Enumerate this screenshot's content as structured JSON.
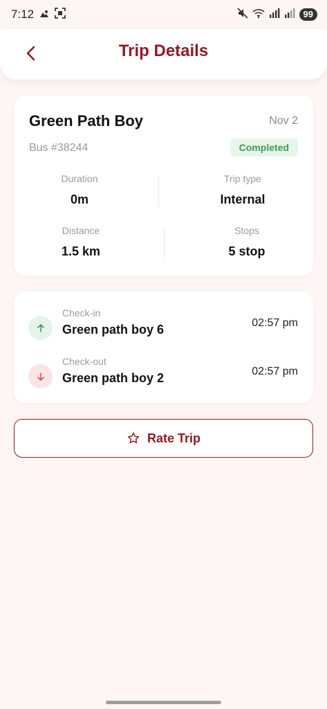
{
  "status_bar": {
    "time": "7:12",
    "battery": "99"
  },
  "header": {
    "title": "Trip Details",
    "back_icon": "chevron-left-icon"
  },
  "trip": {
    "name": "Green Path Boy",
    "date": "Nov 2",
    "bus": "Bus #38244",
    "status": "Completed",
    "stats": {
      "duration": {
        "label": "Duration",
        "value": "0m"
      },
      "trip_type": {
        "label": "Trip type",
        "value": "Internal"
      },
      "distance": {
        "label": "Distance",
        "value": "1.5 km"
      },
      "stops": {
        "label": "Stops",
        "value": "5 stop"
      }
    }
  },
  "checkpoints": [
    {
      "label": "Check-in",
      "name": "Green path boy 6",
      "time": "02:57 pm",
      "icon": "arrow-up-icon"
    },
    {
      "label": "Check-out",
      "name": "Green path boy 2",
      "time": "02:57 pm",
      "icon": "arrow-down-icon"
    }
  ],
  "actions": {
    "rate_label": "Rate Trip",
    "rate_icon": "star-outline-icon"
  },
  "colors": {
    "accent": "#8e1c24",
    "success": "#3d9a52",
    "success_bg": "#e7f5ea",
    "danger": "#d9534f",
    "background": "#fdf6f5"
  }
}
